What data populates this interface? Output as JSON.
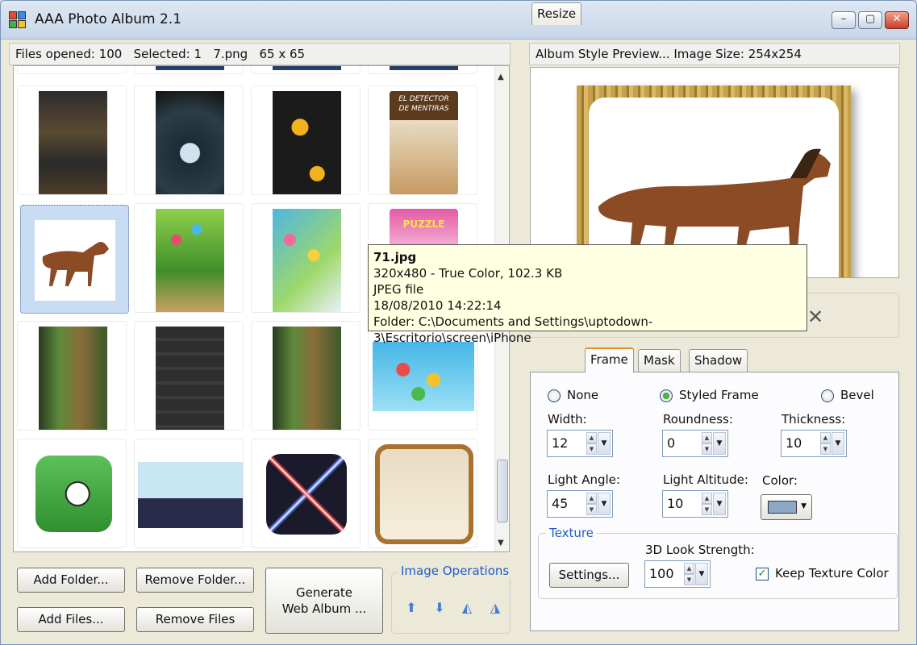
{
  "window": {
    "title": "AAA Photo Album 2.1",
    "controls": {
      "minimize": "–",
      "maximize": "▢",
      "close": "✕"
    }
  },
  "status": {
    "files_info": "Files opened: 100   Selected: 1   7.png   65 x 65"
  },
  "preview": {
    "header": "Album Style Preview... Image Size: 254x254",
    "frame_color": "#c6a14d"
  },
  "tooltip": {
    "filename": "71.jpg",
    "line1": "320x480 - True Color, 102.3 KB",
    "line2": "JPEG file",
    "line3": "18/08/2010 14:22:14",
    "line4": "Folder: C:\\Documents and Settings\\uptodown-3\\Escritorio\\screen\\iPhone"
  },
  "thumbnail_icons": {
    "detector_line1": "EL DETECTOR",
    "detector_line2": "DE MENTIRAS",
    "puzzle": "PUZZLE"
  },
  "buttons": {
    "add_folder": "Add Folder...",
    "remove_folder": "Remove Folder...",
    "generate_line1": "Generate",
    "generate_line2": "Web Album ...",
    "add_files": "Add Files...",
    "remove_files": "Remove Files"
  },
  "image_operations": {
    "title": "Image Operations",
    "icons": [
      "move-up-icon",
      "move-down-icon",
      "rotate-left-icon",
      "rotate-right-icon"
    ]
  },
  "tabs": [
    {
      "label": "Resize",
      "active": false
    },
    {
      "label": "Frame",
      "active": true
    },
    {
      "label": "Mask",
      "active": false
    },
    {
      "label": "Shadow",
      "active": false
    }
  ],
  "frame_tab": {
    "radio_none": "None",
    "radio_styled": "Styled Frame",
    "radio_bevel": "Bevel",
    "selected_radio": "Styled Frame",
    "width_label": "Width:",
    "width_value": "12",
    "roundness_label": "Roundness:",
    "roundness_value": "0",
    "thickness_label": "Thickness:",
    "thickness_value": "10",
    "light_angle_label": "Light Angle:",
    "light_angle_value": "45",
    "light_altitude_label": "Light Altitude:",
    "light_altitude_value": "10",
    "color_label": "Color:",
    "color_value": "#8ea7c4",
    "texture_group": "Texture",
    "settings_button": "Settings...",
    "strength_label": "3D Look Strength:",
    "strength_value": "100",
    "keep_texture_label": "Keep Texture Color",
    "keep_texture_checked": true
  }
}
